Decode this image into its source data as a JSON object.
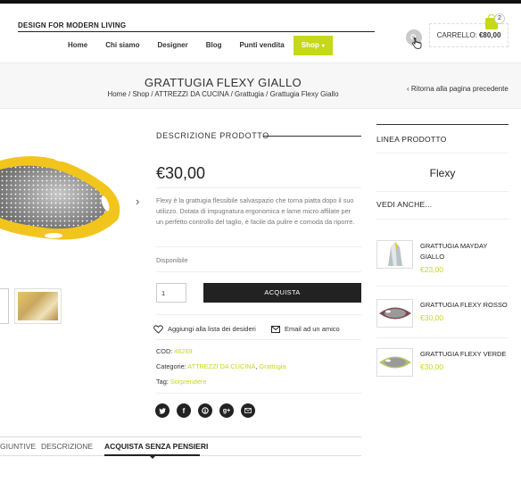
{
  "header": {
    "logo": "DESIGN FOR MODERN LIVING",
    "nav": [
      "Home",
      "Chi siamo",
      "Designer",
      "Blog",
      "Punti vendita",
      "Shop"
    ],
    "cart_label": "CARRELLO:",
    "cart_total": "€80,00",
    "cart_count": "2"
  },
  "title_bar": {
    "title": "GRATTUGIA FLEXY GIALLO",
    "breadcrumb": [
      "Home",
      "Shop",
      "ATTREZZI DA CUCINA",
      "Grattugia",
      "Grattugia Flexy Giallo"
    ],
    "back": "Ritorna alla pagina precedente"
  },
  "product": {
    "section_title": "DESCRIZIONE PRODOTTO",
    "price": "€30,00",
    "description": "Flexy è la grattugia flessibile salvaspazio che torna piatta dopo il suo utilizzo. Dotata di impugnatura ergonomica e lame micro affilate per un perfetto controllo del taglio, è facile da pulire e comoda da riporre.",
    "availability": "Disponibile",
    "quantity": "1",
    "buy_label": "ACQUISTA",
    "wishlist": "Aggiungi alla lista dei desideri",
    "email_friend": "Email ad un amico",
    "cod_label": "COD:",
    "cod": "46269",
    "categories_label": "Categorie:",
    "categories": [
      "ATTREZZI DA CUCINA",
      "Grattugia"
    ],
    "tag_label": "Tag:",
    "tag": "Sorprendere"
  },
  "tabs": [
    "GIUNTIVE",
    "DESCRIZIONE",
    "ACQUISTA SENZA PENSIERI"
  ],
  "sidebar": {
    "line_title": "LINEA PRODOTTO",
    "line_name": "Flexy",
    "see_also": "VEDI ANCHE...",
    "related": [
      {
        "name": "GRATTUGIA MAYDAY GIALLO",
        "price": "€23,00"
      },
      {
        "name": "GRATTUGIA FLEXY ROSSO",
        "price": "€30,00"
      },
      {
        "name": "GRATTUGIA FLEXY VERDE",
        "price": "€30,00"
      }
    ]
  },
  "colors": {
    "accent": "#c5d81a",
    "dark": "#222222"
  },
  "icons": [
    "search-icon",
    "cart-icon",
    "heart-icon",
    "mail-icon",
    "twitter-icon",
    "facebook-icon",
    "pinterest-icon",
    "google-plus-icon",
    "email-share-icon",
    "chevron-right-icon"
  ]
}
